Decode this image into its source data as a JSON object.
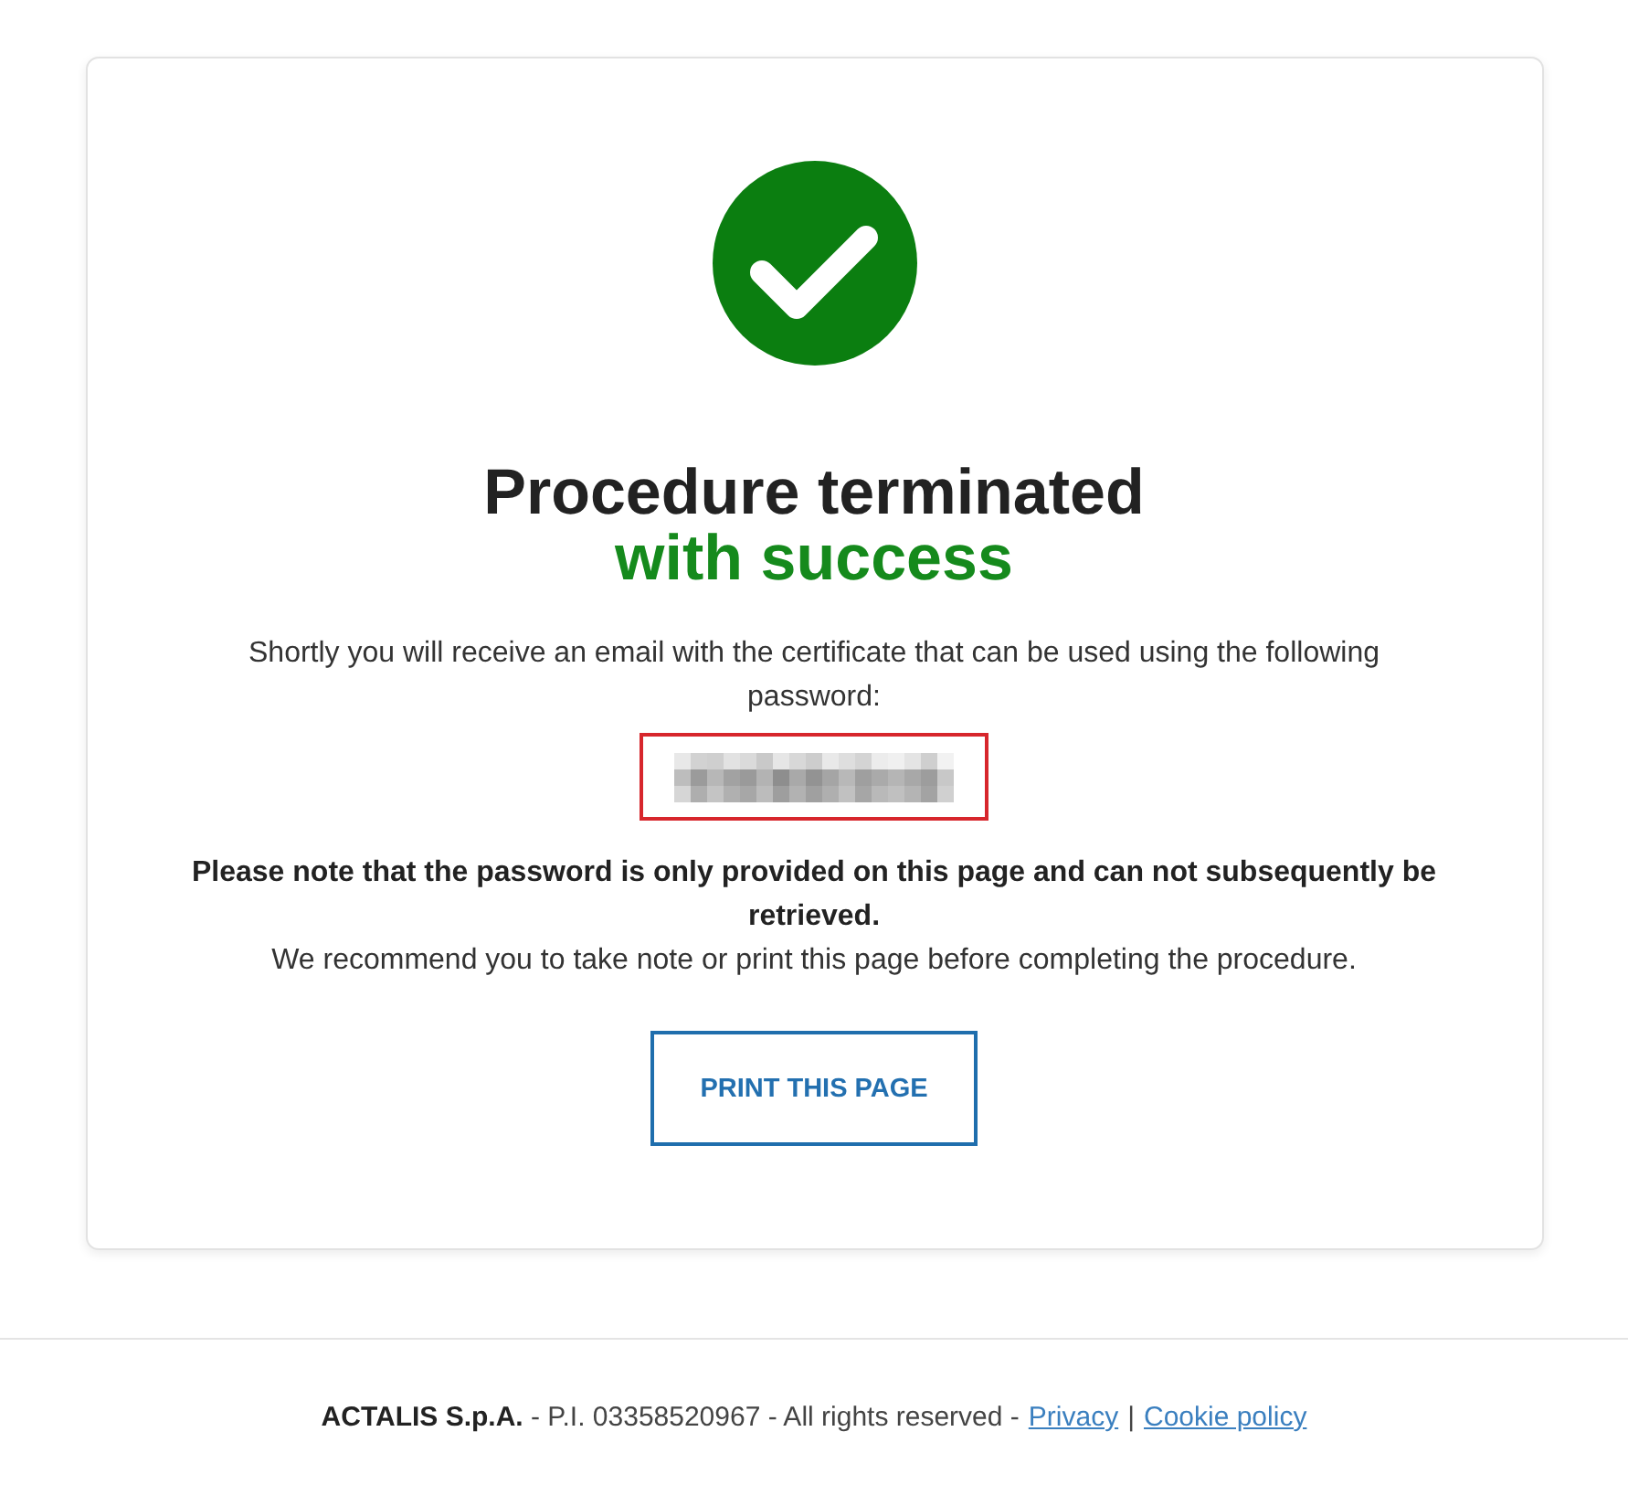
{
  "heading": {
    "line_1": "Procedure terminated",
    "line_2": "with success"
  },
  "message": "Shortly you will receive an email with the certificate that can be used using the following password:",
  "note": {
    "warning": "Please note that the password is only provided on this page and can not subsequently be retrieved.",
    "advice": "We recommend you to take note or print this page before completing the procedure."
  },
  "print_button": {
    "label": "PRINT THIS PAGE"
  },
  "footer": {
    "copyright": "**ACTALIS S.p.A.** - P.I. 03358520967 - All rights reserved -",
    "links": [
      {
        "label": "Privacy"
      },
      {
        "label": "Cookie policy"
      }
    ],
    "separator": "|"
  }
}
